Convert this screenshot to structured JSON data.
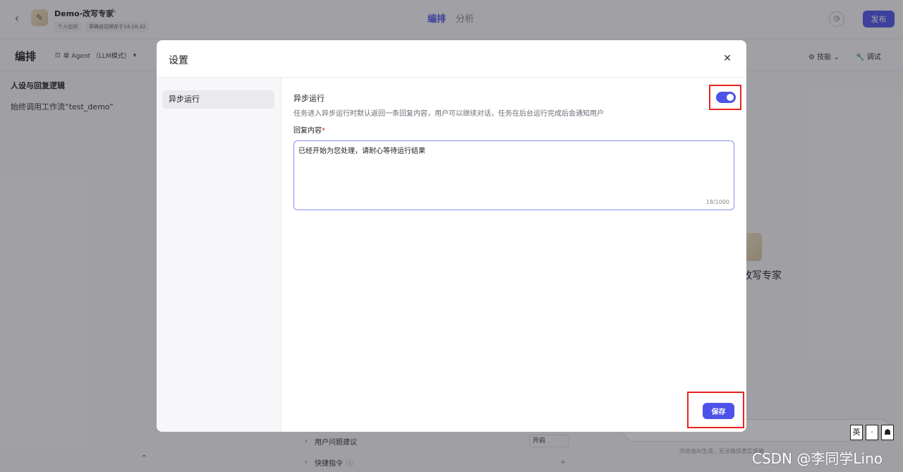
{
  "app": {
    "bot_name": "Demo-改写专家",
    "space_label": "个人空间",
    "autosave_text": "草稿自动保存于14:16:32",
    "tabs": [
      "编排",
      "分析"
    ],
    "publish_label": "发布"
  },
  "subbar": {
    "title": "编排",
    "agent_mode": "单 Agent （LLM模式）",
    "skills_label": "技能",
    "debug_label": "调试"
  },
  "left_pane": {
    "persona_title": "人设与回复逻辑",
    "persona_text": "始终调用工作流“test_demo”"
  },
  "mid_list": {
    "items": [
      {
        "label": "用户问题建议",
        "value": "开启"
      },
      {
        "label": "快捷指令"
      }
    ]
  },
  "preview": {
    "bot_name": "改写专家",
    "note": "内容由AI生成，无法确保真实准确"
  },
  "modal": {
    "title": "设置",
    "side_item": "异步运行",
    "async_label": "异步运行",
    "async_desc": "任务进入异步运行时默认返回一条回复内容，用户可以继续对话，任务在后台运行完成后会通知用户",
    "async_enabled": true,
    "reply_label": "回复内容",
    "reply_text": "已经开始为您处理，请耐心等待运行结果",
    "reply_count": "18/1000",
    "save_label": "保存"
  },
  "colors": {
    "accent": "#4d53e8",
    "highlight": "#e8241d"
  },
  "ime": [
    "英",
    "·",
    "☗"
  ],
  "watermark": "CSDN @李同学Lino"
}
